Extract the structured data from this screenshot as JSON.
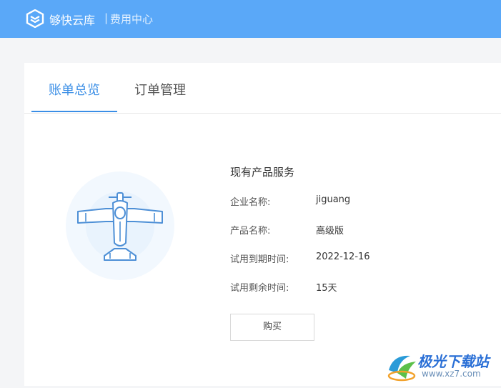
{
  "app": {
    "brand": "够快云库",
    "separator": "|",
    "section": "费用中心"
  },
  "tabs": [
    {
      "label": "账单总览",
      "active": true
    },
    {
      "label": "订单管理",
      "active": false
    }
  ],
  "illustration": {
    "icon": "airplane-icon"
  },
  "service": {
    "title": "现有产品服务",
    "rows": [
      {
        "label": "企业名称:",
        "value": "jiguang"
      },
      {
        "label": "产品名称:",
        "value": "高级版"
      },
      {
        "label": "试用到期时间:",
        "value": "2022-12-16"
      },
      {
        "label": "试用剩余时间:",
        "value": "15天"
      }
    ],
    "buy_label": "购买"
  },
  "watermark": {
    "text": "极光下载站",
    "url": "www.xz7.com"
  },
  "colors": {
    "topbar": "#5aa8f8",
    "accent": "#3a8ee6"
  }
}
